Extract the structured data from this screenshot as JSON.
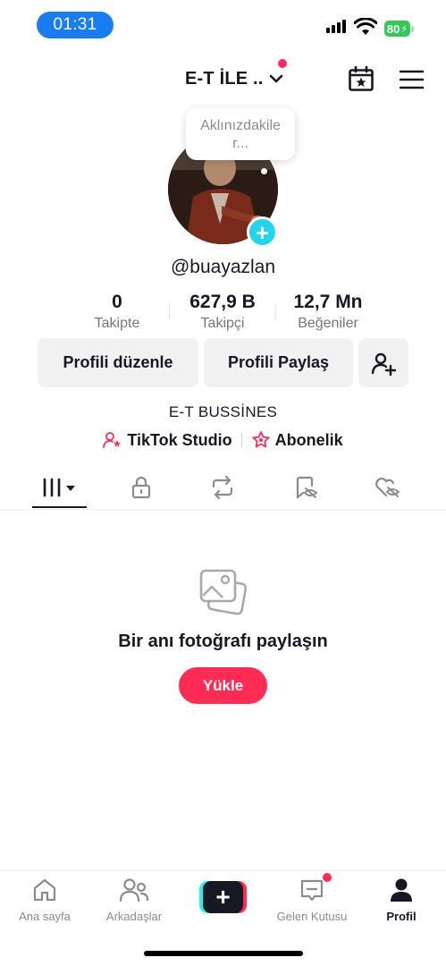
{
  "status_bar": {
    "time": "01:31",
    "battery": "80"
  },
  "header": {
    "account_name": "E-T İLE ..",
    "has_notification_dot": true
  },
  "profile": {
    "bubble_text": "Aklınızdakiler...",
    "username": "@buayazlan",
    "stats": [
      {
        "value": "0",
        "label": "Takipte"
      },
      {
        "value": "627,9 B",
        "label": "Takipçi"
      },
      {
        "value": "12,7 Mn",
        "label": "Beğeniler"
      }
    ],
    "edit_button": "Profili düzenle",
    "share_button": "Profili Paylaş",
    "bio": "E-T BUSSİNES",
    "links": {
      "studio": "TikTok Studio",
      "subscription": "Abonelik"
    }
  },
  "tabs": [
    {
      "icon": "grid-icon",
      "active": true
    },
    {
      "icon": "lock-icon",
      "active": false
    },
    {
      "icon": "repost-icon",
      "active": false
    },
    {
      "icon": "favorites-hidden-icon",
      "active": false
    },
    {
      "icon": "liked-hidden-icon",
      "active": false
    }
  ],
  "empty_state": {
    "title": "Bir anı fotoğrafı paylaşın",
    "button": "Yükle"
  },
  "bottom_nav": {
    "home": "Ana sayfa",
    "friends": "Arkadaşlar",
    "inbox": "Gelen Kutusu",
    "profile": "Profil",
    "active": "profile"
  },
  "colors": {
    "accent": "#fe2c55",
    "cyan": "#20d5ec",
    "status_pill": "#1a7cf2",
    "battery": "#34c759"
  }
}
